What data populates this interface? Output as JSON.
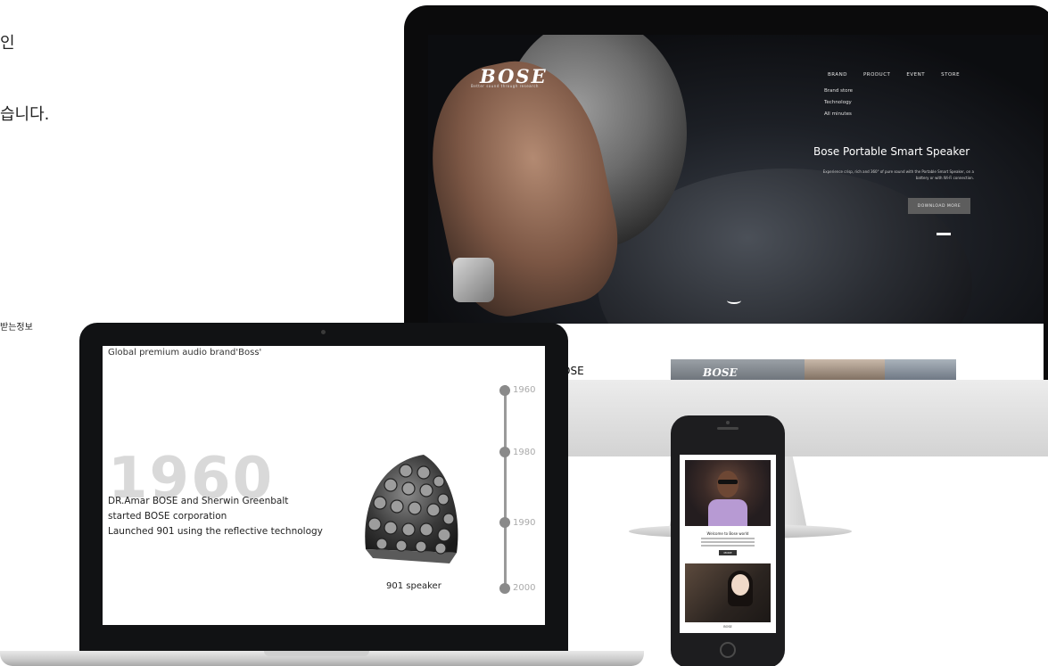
{
  "left_text": {
    "line1": "인",
    "line2": "습니다.",
    "line3": "받는정보"
  },
  "imac_site": {
    "logo": "BOSE",
    "logo_sub": "Better sound through research",
    "nav": [
      "BRAND",
      "PRODUCT",
      "EVENT",
      "STORE"
    ],
    "subnav": [
      "Brand store",
      "Technology",
      "All minutes"
    ],
    "hero_title": "Bose Portable Smart Speaker",
    "hero_desc": "Experience crisp, rich and 360° of pure sound with the Portable Smart Speaker, on a battery or with Wi-Fi connection.",
    "hero_button": "DOWNLOAD MORE",
    "section_text": "OSE",
    "thumb_logo": "BOSE"
  },
  "macbook_site": {
    "heading": "Global premium audio brand'Boss'",
    "big_year": "1960",
    "story_lines": [
      "DR.Amar BOSE and Sherwin Greenbalt",
      "started BOSE corporation",
      "Launched 901 using the reflective technology"
    ],
    "years": [
      "1960",
      "1980",
      "1990",
      "2000"
    ],
    "speaker_caption": "901 speaker"
  },
  "phone_site": {
    "title": "Welcome to Bose world",
    "button": "MORE",
    "caption": "BOSE"
  },
  "colors": {
    "imac_frame": "#0b0b0c",
    "imac_chin": "#dcdcdc",
    "timeline": "#9a9a9a",
    "hero_button": "#5d5d5d"
  }
}
